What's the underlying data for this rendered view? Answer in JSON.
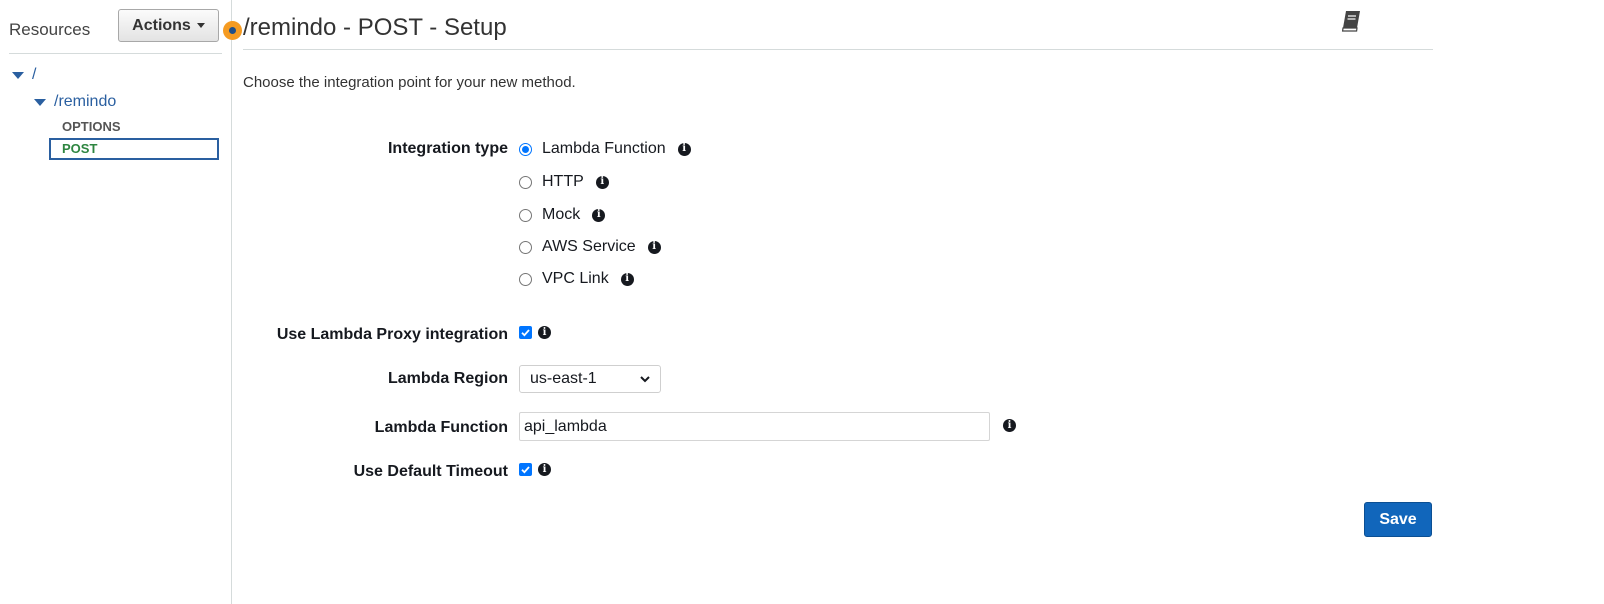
{
  "sidebar": {
    "title": "Resources",
    "actions_label": "Actions",
    "tree": {
      "root": "/",
      "resource": "/remindo",
      "methods": [
        "OPTIONS",
        "POST"
      ]
    }
  },
  "main": {
    "title": "/remindo - POST - Setup",
    "intro": "Choose the integration point for your new method.",
    "integration_type": {
      "label": "Integration type",
      "options": [
        "Lambda Function",
        "HTTP",
        "Mock",
        "AWS Service",
        "VPC Link"
      ],
      "selected": "Lambda Function"
    },
    "proxy": {
      "label": "Use Lambda Proxy integration",
      "checked": true
    },
    "region": {
      "label": "Lambda Region",
      "value": "us-east-1"
    },
    "function": {
      "label": "Lambda Function",
      "value": "api_lambda"
    },
    "timeout": {
      "label": "Use Default Timeout",
      "checked": true
    },
    "save_label": "Save"
  },
  "colors": {
    "link": "#2a5fa0",
    "accent_orange": "#f59b22",
    "primary_button": "#1166bb",
    "post_method": "#2e8540",
    "check_blue": "#0075ff"
  },
  "icons": {
    "doc": "book-icon",
    "info": "info-icon",
    "status": "status-dot"
  }
}
